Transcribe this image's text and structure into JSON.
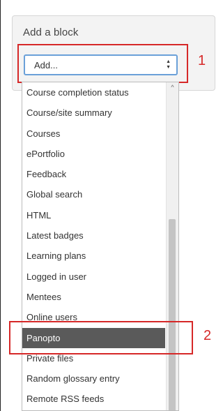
{
  "block": {
    "title": "Add a block",
    "select_value": "Add...",
    "arrows_up": "▲",
    "arrows_down": "▼"
  },
  "dropdown": {
    "items": [
      "Course completion status",
      "Course/site summary",
      "Courses",
      "ePortfolio",
      "Feedback",
      "Global search",
      "HTML",
      "Latest badges",
      "Learning plans",
      "Logged in user",
      "Mentees",
      "Online users",
      "Panopto",
      "Private files",
      "Random glossary entry",
      "Remote RSS feeds"
    ],
    "selected": "Panopto",
    "scroll_up_icon": "^"
  },
  "annotations": {
    "label1": "1",
    "label2": "2",
    "color": "#d62828"
  },
  "colors": {
    "select_border": "#6aa0d8",
    "selected_bg": "#5a5a5a"
  }
}
